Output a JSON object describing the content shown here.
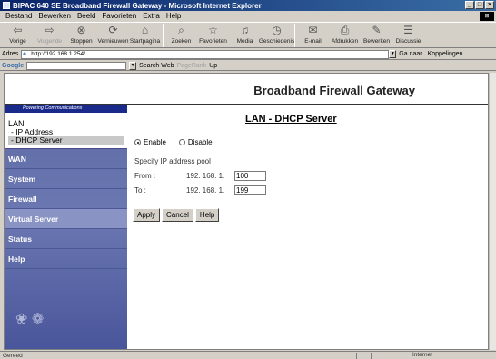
{
  "window": {
    "title": "BIPAC 640 SE Broadband Firewall Gateway - Microsoft Internet Explorer"
  },
  "menu": [
    "Bestand",
    "Bewerken",
    "Beeld",
    "Favorieten",
    "Extra",
    "Help"
  ],
  "toolbar": {
    "back": "Vorige",
    "forward": "Volgende",
    "stop": "Stoppen",
    "refresh": "Vernieuwen",
    "home": "Startpagina",
    "search": "Zoeken",
    "favorites": "Favorieten",
    "media": "Media",
    "history": "Geschiedenis",
    "mail": "E-mail",
    "print": "Afdrukken",
    "edit": "Bewerken",
    "discuss": "Discussie"
  },
  "address": {
    "label": "Adres",
    "url": "http://192.168.1.254/",
    "go": "Ga naar",
    "links": "Koppelingen"
  },
  "googlebar": {
    "logo": "Google",
    "search_web": "Search Web",
    "pagerank": "PageRank",
    "up": "Up"
  },
  "router": {
    "header_title": "Broadband Firewall Gateway",
    "slogan": "Powering Communications",
    "nav": {
      "lan": "LAN",
      "ip_address": "- IP Address",
      "dhcp_server": "- DHCP Server",
      "wan": "WAN",
      "system": "System",
      "firewall": "Firewall",
      "virtual_server": "Virtual Server",
      "status": "Status",
      "help": "Help"
    }
  },
  "dhcp": {
    "page_title": "LAN - DHCP Server",
    "enable_label": "Enable",
    "disable_label": "Disable",
    "enabled": true,
    "pool_label": "Specify IP address pool",
    "from_label": "From :",
    "to_label": "To :",
    "ip_prefix": "192. 168. 1.",
    "from_value": "100",
    "to_value": "199",
    "apply": "Apply",
    "cancel": "Cancel",
    "help": "Help"
  },
  "status": {
    "text": "Gereed",
    "zone": "Internet"
  }
}
